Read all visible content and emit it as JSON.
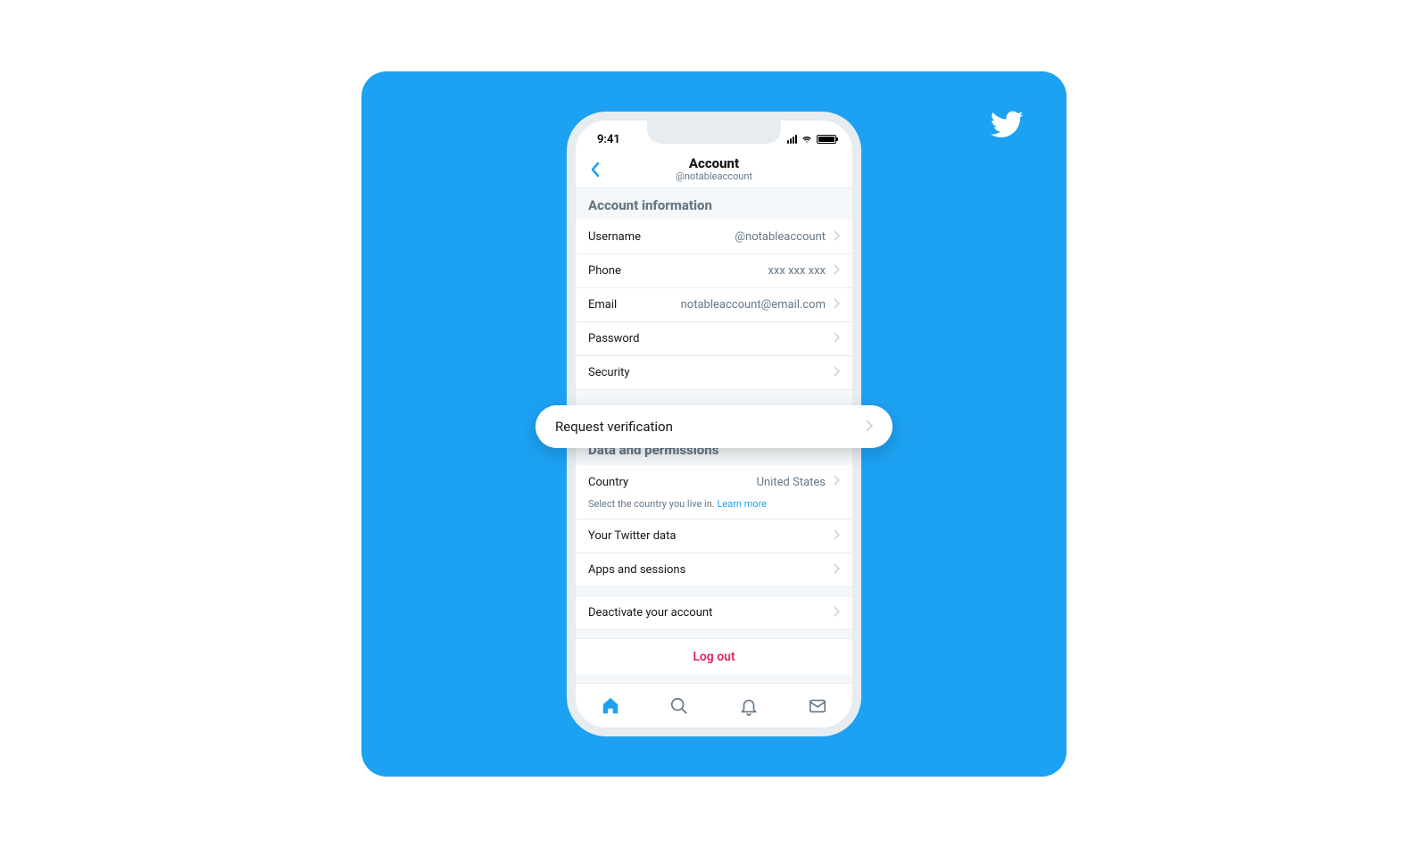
{
  "status": {
    "time": "9:41"
  },
  "header": {
    "title": "Account",
    "subtitle": "@notableaccount"
  },
  "sections": {
    "account_info": {
      "title": "Account information",
      "username": {
        "label": "Username",
        "value": "@notableaccount"
      },
      "phone": {
        "label": "Phone",
        "value": "xxx xxx xxx"
      },
      "email": {
        "label": "Email",
        "value": "notableaccount@email.com"
      },
      "password": {
        "label": "Password"
      },
      "security": {
        "label": "Security"
      }
    },
    "callout": {
      "label": "Request verification"
    },
    "data_perms": {
      "title": "Data and permissions",
      "country": {
        "label": "Country",
        "value": "United States",
        "helper": "Select the country you live in.",
        "learn": "Learn more"
      },
      "your_data": {
        "label": "Your Twitter data"
      },
      "apps": {
        "label": "Apps and sessions"
      },
      "deactivate": {
        "label": "Deactivate your account"
      }
    },
    "logout": "Log out"
  }
}
